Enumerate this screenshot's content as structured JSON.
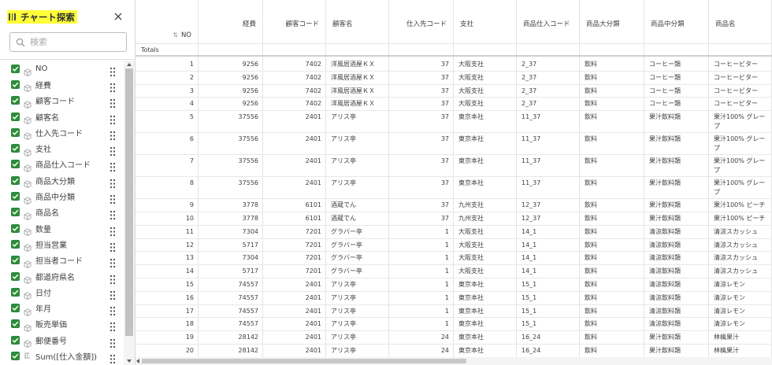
{
  "sidebar": {
    "title": "チャート探索",
    "search_placeholder": "検索",
    "fields": [
      {
        "label": "NO",
        "type": "dimension"
      },
      {
        "label": "経費",
        "type": "dimension"
      },
      {
        "label": "顧客コード",
        "type": "dimension"
      },
      {
        "label": "顧客名",
        "type": "dimension"
      },
      {
        "label": "仕入先コード",
        "type": "dimension"
      },
      {
        "label": "支社",
        "type": "dimension"
      },
      {
        "label": "商品仕入コード",
        "type": "dimension"
      },
      {
        "label": "商品大分類",
        "type": "dimension"
      },
      {
        "label": "商品中分類",
        "type": "dimension"
      },
      {
        "label": "商品名",
        "type": "dimension"
      },
      {
        "label": "数量",
        "type": "dimension"
      },
      {
        "label": "担当営業",
        "type": "dimension"
      },
      {
        "label": "担当者コード",
        "type": "dimension"
      },
      {
        "label": "都道府県名",
        "type": "dimension"
      },
      {
        "label": "日付",
        "type": "dimension"
      },
      {
        "label": "年月",
        "type": "dimension"
      },
      {
        "label": "販売単価",
        "type": "dimension"
      },
      {
        "label": "郵便番号",
        "type": "dimension"
      },
      {
        "label": "Sum([仕入金額])",
        "type": "measure"
      }
    ]
  },
  "table": {
    "totals_label": "Totals",
    "columns": [
      {
        "key": "no",
        "label": "NO",
        "align": "right",
        "sort": "⇅"
      },
      {
        "key": "keihi",
        "label": "経費",
        "align": "right"
      },
      {
        "key": "kokyaku_code",
        "label": "顧客コード",
        "align": "right"
      },
      {
        "key": "kokyaku_name",
        "label": "顧客名",
        "align": "left"
      },
      {
        "key": "shiiresaki_code",
        "label": "仕入先コード",
        "align": "right"
      },
      {
        "key": "shisha",
        "label": "支社",
        "align": "left"
      },
      {
        "key": "shohin_shiire_code",
        "label": "商品仕入コード",
        "align": "left"
      },
      {
        "key": "shohin_dai",
        "label": "商品大分類",
        "align": "left"
      },
      {
        "key": "shohin_chu",
        "label": "商品中分類",
        "align": "left"
      },
      {
        "key": "shohin_name",
        "label": "商品名",
        "align": "left"
      }
    ],
    "rows": [
      [
        "1",
        "9256",
        "7402",
        "洋風居酒屋ＫＸ",
        "37",
        "大阪支社",
        "2_37",
        "飲料",
        "コーヒー類",
        "コーヒービター"
      ],
      [
        "2",
        "9256",
        "7402",
        "洋風居酒屋ＫＸ",
        "37",
        "大阪支社",
        "2_37",
        "飲料",
        "コーヒー類",
        "コーヒービター"
      ],
      [
        "3",
        "9256",
        "7402",
        "洋風居酒屋ＫＸ",
        "37",
        "大阪支社",
        "2_37",
        "飲料",
        "コーヒー類",
        "コーヒービター"
      ],
      [
        "4",
        "9256",
        "7402",
        "洋風居酒屋ＫＸ",
        "37",
        "大阪支社",
        "2_37",
        "飲料",
        "コーヒー類",
        "コーヒービター"
      ],
      [
        "5",
        "37556",
        "2401",
        "アリス亭",
        "37",
        "東京本社",
        "11_37",
        "飲料",
        "果汁飲料類",
        "果汁100% グレープ"
      ],
      [
        "6",
        "37556",
        "2401",
        "アリス亭",
        "37",
        "東京本社",
        "11_37",
        "飲料",
        "果汁飲料類",
        "果汁100% グレープ"
      ],
      [
        "7",
        "37556",
        "2401",
        "アリス亭",
        "37",
        "東京本社",
        "11_37",
        "飲料",
        "果汁飲料類",
        "果汁100% グレープ"
      ],
      [
        "8",
        "37556",
        "2401",
        "アリス亭",
        "37",
        "東京本社",
        "11_37",
        "飲料",
        "果汁飲料類",
        "果汁100% グレープ"
      ],
      [
        "9",
        "3778",
        "6101",
        "酒蔵でん",
        "37",
        "九州支社",
        "12_37",
        "飲料",
        "果汁飲料類",
        "果汁100% ピーチ"
      ],
      [
        "10",
        "3778",
        "6101",
        "酒蔵でん",
        "37",
        "九州支社",
        "12_37",
        "飲料",
        "果汁飲料類",
        "果汁100% ピーチ"
      ],
      [
        "11",
        "7304",
        "7201",
        "グラバー亭",
        "1",
        "大阪支社",
        "14_1",
        "飲料",
        "清涼飲料類",
        "清涼スカッシュ"
      ],
      [
        "12",
        "5717",
        "7201",
        "グラバー亭",
        "1",
        "大阪支社",
        "14_1",
        "飲料",
        "清涼飲料類",
        "清涼スカッシュ"
      ],
      [
        "13",
        "7304",
        "7201",
        "グラバー亭",
        "1",
        "大阪支社",
        "14_1",
        "飲料",
        "清涼飲料類",
        "清涼スカッシュ"
      ],
      [
        "14",
        "5717",
        "7201",
        "グラバー亭",
        "1",
        "大阪支社",
        "14_1",
        "飲料",
        "清涼飲料類",
        "清涼スカッシュ"
      ],
      [
        "15",
        "74557",
        "2401",
        "アリス亭",
        "1",
        "東京本社",
        "15_1",
        "飲料",
        "清涼飲料類",
        "清涼レモン"
      ],
      [
        "16",
        "74557",
        "2401",
        "アリス亭",
        "1",
        "東京本社",
        "15_1",
        "飲料",
        "清涼飲料類",
        "清涼レモン"
      ],
      [
        "17",
        "74557",
        "2401",
        "アリス亭",
        "1",
        "東京本社",
        "15_1",
        "飲料",
        "清涼飲料類",
        "清涼レモン"
      ],
      [
        "18",
        "74557",
        "2401",
        "アリス亭",
        "1",
        "東京本社",
        "15_1",
        "飲料",
        "清涼飲料類",
        "清涼レモン"
      ],
      [
        "19",
        "28142",
        "2401",
        "アリス亭",
        "24",
        "東京本社",
        "16_24",
        "飲料",
        "果汁飲料類",
        "林檎果汁"
      ],
      [
        "20",
        "28142",
        "2401",
        "アリス亭",
        "24",
        "東京本社",
        "16_24",
        "飲料",
        "果汁飲料類",
        "林檎果汁"
      ]
    ]
  }
}
